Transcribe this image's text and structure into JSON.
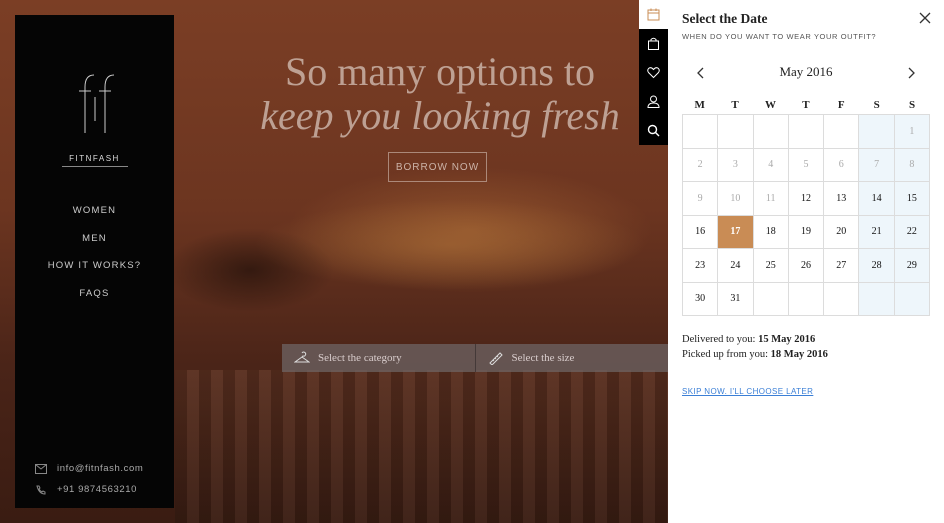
{
  "hero": {
    "title_line1": "So many options to",
    "title_line2": "keep you looking fresh",
    "borrow_label": "BORROW NOW",
    "category_placeholder": "Select the category",
    "size_placeholder": "Select the size"
  },
  "sidebar": {
    "logo_icon": "fitnfash-logo-icon",
    "brand": "FITNFASH",
    "nav": [
      {
        "label": "WOMEN"
      },
      {
        "label": "MEN"
      },
      {
        "label": "HOW IT WORKS?"
      },
      {
        "label": "FAQS"
      }
    ],
    "email": "info@fitnfash.com",
    "phone": "+91 9874563210"
  },
  "icon_strip": [
    {
      "icon": "calendar-icon",
      "active": true
    },
    {
      "icon": "shopping-bag-icon",
      "active": false
    },
    {
      "icon": "heart-icon",
      "active": false
    },
    {
      "icon": "user-icon",
      "active": false
    },
    {
      "icon": "search-icon",
      "active": false
    }
  ],
  "date_panel": {
    "title": "Select the Date",
    "subtitle": "WHEN DO YOU WANT TO WEAR YOUR OUTFIT?",
    "month": "May 2016",
    "weekdays": [
      "M",
      "T",
      "W",
      "T",
      "F",
      "S",
      "S"
    ],
    "weeks": [
      [
        "",
        "",
        "",
        "",
        "",
        "",
        "1"
      ],
      [
        "2",
        "3",
        "4",
        "5",
        "6",
        "7",
        "8"
      ],
      [
        "9",
        "10",
        "11",
        "12",
        "13",
        "14",
        "15"
      ],
      [
        "16",
        "17",
        "18",
        "19",
        "20",
        "21",
        "22"
      ],
      [
        "23",
        "24",
        "25",
        "26",
        "27",
        "28",
        "29"
      ],
      [
        "30",
        "31",
        "",
        "",
        "",
        "",
        ""
      ]
    ],
    "disabled_days": [
      "1",
      "2",
      "3",
      "4",
      "5",
      "6",
      "7",
      "8",
      "9",
      "10",
      "11"
    ],
    "selected_day": "17",
    "delivered_label": "Delivered to you:",
    "delivered_date": "15 May 2016",
    "pickup_label": "Picked up from you:",
    "pickup_date": "18 May 2016",
    "skip_label": "SKIP NOW. I'LL CHOOSE LATER"
  },
  "colors": {
    "accent": "#c98c55",
    "link": "#3b7fd6",
    "weekend_bg": "#eef6fb"
  }
}
